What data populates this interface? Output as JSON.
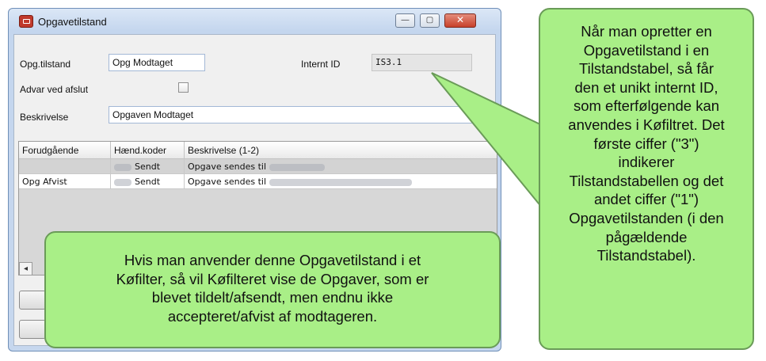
{
  "window": {
    "title": "Opgavetilstand",
    "minimize_glyph": "—",
    "maximize_glyph": "▢",
    "close_glyph": "✕"
  },
  "form": {
    "state_label": "Opg.tilstand",
    "state_value": "Opg Modtaget",
    "internal_id_label": "Internt ID",
    "internal_id_value": "IS3.1",
    "warn_label": "Advar ved afslut",
    "warn_checked": false,
    "description_label": "Beskrivelse",
    "description_value": "Opgaven Modtaget"
  },
  "grid": {
    "columns": [
      "Forudgående",
      "Hænd.koder",
      "Beskrivelse  (1-2)"
    ],
    "rows": [
      {
        "previous": "",
        "code": "Sendt",
        "description": "Opgave sendes til"
      },
      {
        "previous": "Opg Afvist",
        "code": "Sendt",
        "description": "Opgave sendes til"
      }
    ]
  },
  "scroll_left_glyph": "◂",
  "callouts": {
    "right": "Når man opretter en Opgavetilstand i en Tilstandstabel, så får den et unikt internt ID, som efterfølgende kan anvendes i Køfiltret. Det første ciffer (\"3\") indikerer Tilstandstabellen og det andet ciffer (\"1\") Opgavetilstanden (i den pågældende Tilstandstabel).",
    "right_lines": [
      "Når man opretter en",
      "Opgavetilstand i en",
      "Tilstandstabel, så får",
      "den et unikt internt ID,",
      "som efterfølgende kan",
      "anvendes i Køfiltret. Det",
      "første ciffer (\"3\")",
      "indikerer",
      "Tilstandstabellen og det",
      "andet ciffer (\"1\")",
      "Opgavetilstanden (i den",
      "pågældende",
      "Tilstandstabel)."
    ],
    "bottom_lines": [
      "Hvis man anvender denne Opgavetilstand i et",
      "Køfilter, så vil Køfilteret vise de Opgaver, som er",
      "blevet tildelt/afsendt, men endnu ikke",
      "accepteret/afvist af modtageren."
    ],
    "fill_color": "#a9ef87",
    "border_color": "#6a9b58"
  }
}
